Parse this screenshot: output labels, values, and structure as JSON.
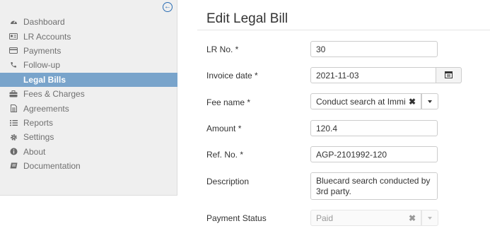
{
  "sidebar": {
    "items": [
      {
        "label": "Dashboard",
        "icon": "dashboard-icon"
      },
      {
        "label": "LR Accounts",
        "icon": "address-card-icon"
      },
      {
        "label": "Payments",
        "icon": "credit-card-icon"
      },
      {
        "label": "Follow-up",
        "icon": "phone-icon"
      },
      {
        "label": "Legal Bills",
        "icon": "gavel-icon",
        "active": true
      },
      {
        "label": "Fees & Charges",
        "icon": "briefcase-icon"
      },
      {
        "label": "Agreements",
        "icon": "file-text-icon"
      },
      {
        "label": "Reports",
        "icon": "list-icon"
      },
      {
        "label": "Settings",
        "icon": "gear-icon"
      },
      {
        "label": "About",
        "icon": "info-icon"
      },
      {
        "label": "Documentation",
        "icon": "book-icon"
      }
    ],
    "collapse_icon": "arrow-circle-left-icon"
  },
  "page": {
    "title": "Edit Legal Bill"
  },
  "form": {
    "lr_no": {
      "label": "LR No. *",
      "value": "30"
    },
    "invoice_date": {
      "label": "Invoice date *",
      "value": "2021-11-03"
    },
    "fee_name": {
      "label": "Fee name *",
      "value": "Conduct search at Immigra"
    },
    "amount": {
      "label": "Amount *",
      "value": "120.4"
    },
    "ref_no": {
      "label": "Ref. No. *",
      "value": "AGP-2101992-120"
    },
    "description": {
      "label": "Description",
      "value": "Bluecard search conducted by 3rd party."
    },
    "payment_status": {
      "label": "Payment Status",
      "value": "Paid",
      "disabled": true
    }
  },
  "colors": {
    "active_nav": "#79a4cb",
    "collapse_icon": "#2a6db4",
    "sidebar_bg": "#efefef"
  }
}
